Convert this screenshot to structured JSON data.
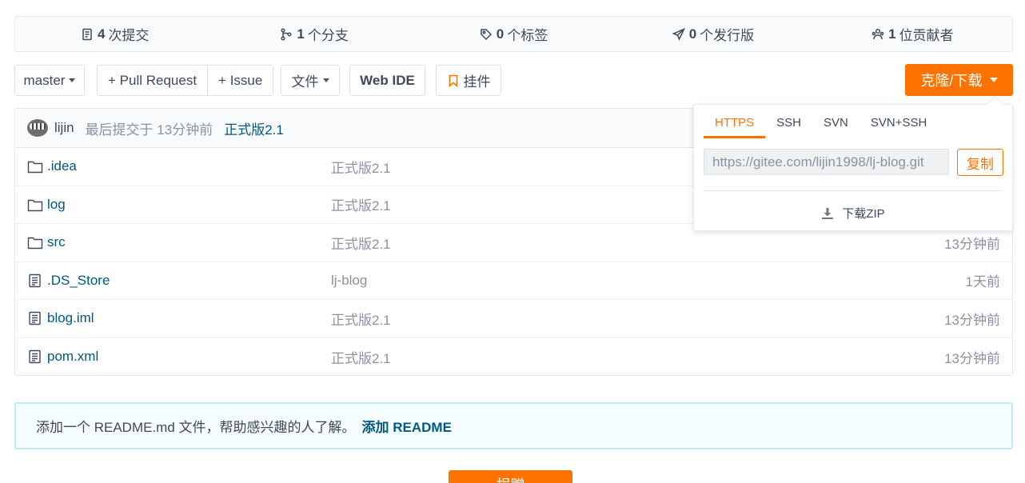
{
  "stats": [
    {
      "icon": "commit-icon",
      "count": "4",
      "label": "次提交"
    },
    {
      "icon": "branch-icon",
      "count": "1",
      "label": "个分支"
    },
    {
      "icon": "tag-icon",
      "count": "0",
      "label": "个标签"
    },
    {
      "icon": "release-icon",
      "count": "0",
      "label": "个发行版"
    },
    {
      "icon": "contributors-icon",
      "count": "1",
      "label": "位贡献者"
    }
  ],
  "toolbar": {
    "branch": "master",
    "pull_request": "+ Pull Request",
    "issue": "+ Issue",
    "file_menu": "文件",
    "web_ide": "Web IDE",
    "widget": "挂件",
    "clone": "克隆/下载"
  },
  "commit": {
    "author": "lijin",
    "time": "最后提交于 13分钟前",
    "message": "正式版2.1"
  },
  "files": [
    {
      "type": "folder",
      "name": ".idea",
      "message": "正式版2.1",
      "time": ""
    },
    {
      "type": "folder",
      "name": "log",
      "message": "正式版2.1",
      "time": ""
    },
    {
      "type": "folder",
      "name": "src",
      "message": "正式版2.1",
      "time": "13分钟前"
    },
    {
      "type": "file",
      "name": ".DS_Store",
      "message": "lj-blog",
      "time": "1天前"
    },
    {
      "type": "file",
      "name": "blog.iml",
      "message": "正式版2.1",
      "time": "13分钟前"
    },
    {
      "type": "file",
      "name": "pom.xml",
      "message": "正式版2.1",
      "time": "13分钟前"
    }
  ],
  "clone_dropdown": {
    "tabs": [
      "HTTPS",
      "SSH",
      "SVN",
      "SVN+SSH"
    ],
    "active_tab": "HTTPS",
    "url": "https://gitee.com/lijin1998/lj-blog.git",
    "copy_label": "复制",
    "download_zip": "下载ZIP"
  },
  "readme": {
    "text": "添加一个 README.md 文件，帮助感兴趣的人了解。",
    "link": "添加 README"
  },
  "bottom_button": "捐赠",
  "colors": {
    "accent": "#fe7300",
    "link": "#005980"
  }
}
